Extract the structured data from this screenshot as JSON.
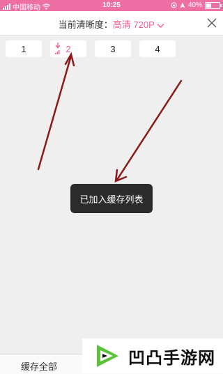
{
  "status_bar": {
    "carrier": "中国移动",
    "time": "10:25",
    "battery": "40%"
  },
  "header": {
    "quality_label": "当前清晰度：",
    "quality_value": "高清 720P",
    "icons": {
      "close": "close-icon",
      "dropdown": "chevron-down-icon"
    }
  },
  "episodes": [
    {
      "label": "1"
    },
    {
      "label": "2"
    },
    {
      "label": "3"
    },
    {
      "label": "4"
    }
  ],
  "toast": {
    "text": "已加入缓存列表"
  },
  "bottom_bar": {
    "save_all": "缓存全部"
  },
  "logo": {
    "text": "凹凸手游网"
  },
  "colors": {
    "accent": "#ee5e9b",
    "status_bar": "#ee6fa4",
    "arrow": "#8b1a1a",
    "toast_bg": "#2b2b2b"
  }
}
